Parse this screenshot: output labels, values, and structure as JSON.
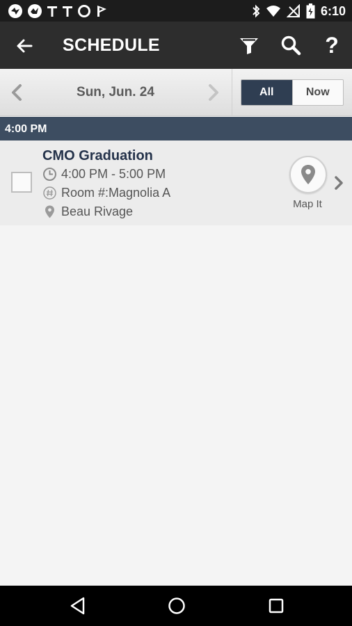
{
  "status_bar": {
    "time": "6:10",
    "icons": [
      "app-icon-1",
      "app-icon-2",
      "t-icon",
      "t-icon",
      "circle-icon",
      "flag-icon",
      "bluetooth-icon",
      "wifi-icon",
      "no-signal-icon",
      "battery-icon"
    ]
  },
  "app_bar": {
    "title": "SCHEDULE",
    "actions": [
      "back-icon",
      "filter-icon",
      "search-icon",
      "help-icon"
    ],
    "help_glyph": "?"
  },
  "date_nav": {
    "date": "Sun, Jun. 24",
    "segments": [
      "All",
      "Now"
    ],
    "selected": "All"
  },
  "schedule": {
    "sections": [
      {
        "time": "4:00  PM",
        "events": [
          {
            "title": "CMO Graduation",
            "time_range": "4:00 PM - 5:00 PM",
            "room": "Room #:Magnolia A",
            "venue": "Beau Rivage",
            "map_label": "Map It",
            "checked": false
          }
        ]
      }
    ]
  },
  "colors": {
    "status_bar": "#1c1c1c",
    "app_bar": "#2d2d2d",
    "accent": "#2f3e52",
    "section_header": "#3d4d61",
    "title_text": "#24324a"
  }
}
